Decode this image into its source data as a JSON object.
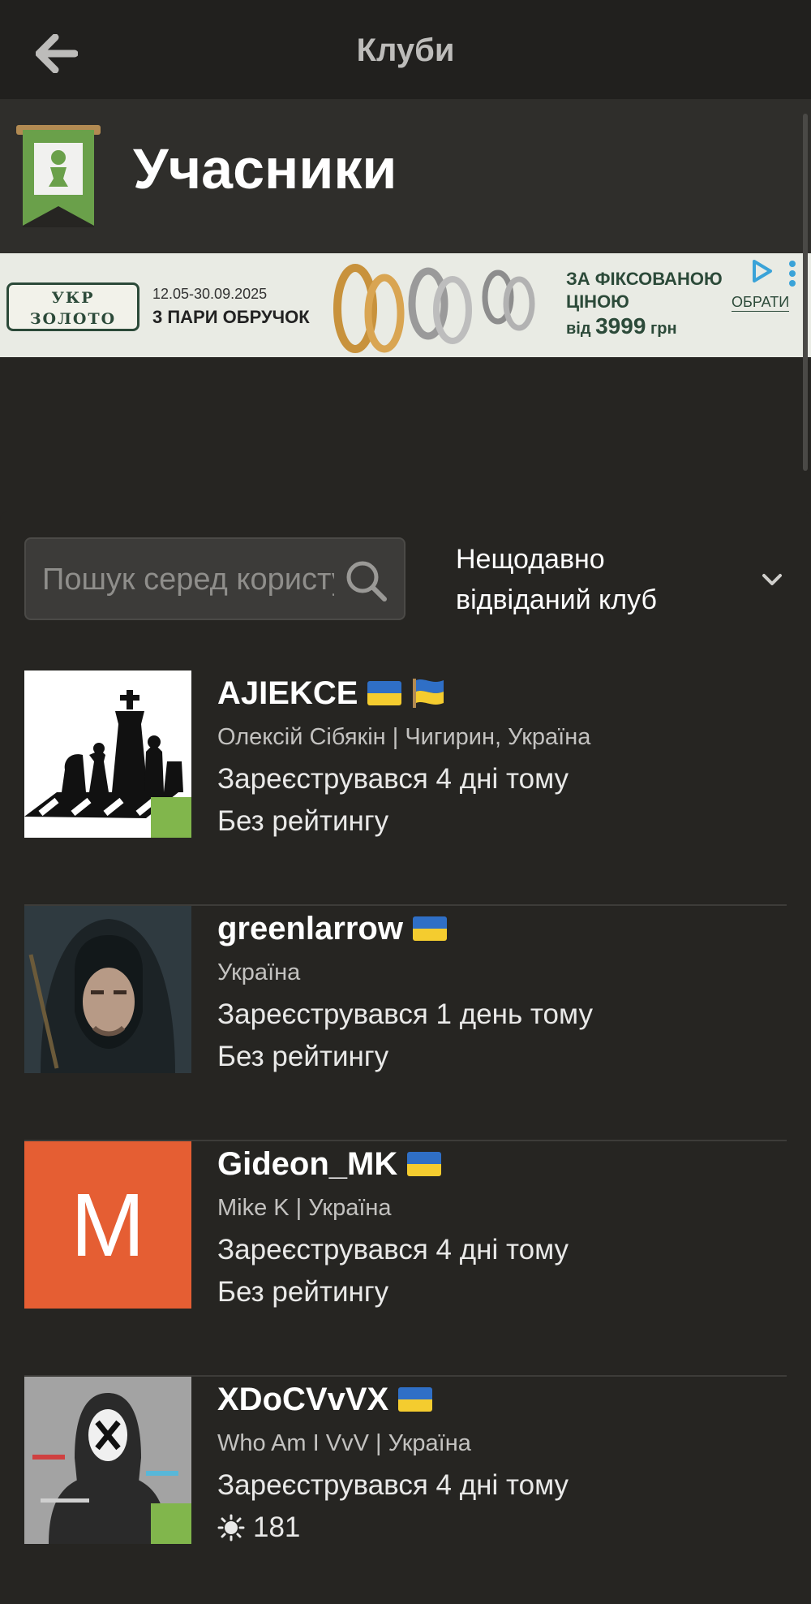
{
  "topbar": {
    "title": "Клуби"
  },
  "header": {
    "title": "Учасники"
  },
  "ad": {
    "brand_line1": "УКР",
    "brand_line2": "ЗОЛОТО",
    "dates": "12.05-30.09.2025",
    "offer": "3 ПАРИ ОБРУЧОК",
    "fixed_line1": "ЗА ФІКСОВАНОЮ",
    "fixed_line2": "ЦІНОЮ",
    "price_prefix": "від",
    "price_value": "3999",
    "price_currency": "грн",
    "cta": "ОБРАТИ"
  },
  "search": {
    "placeholder": "Пошук серед користувачів"
  },
  "filter": {
    "selected": "Нещодавно відвіданий клуб"
  },
  "members": [
    {
      "username": "AJIEKCE",
      "realname": "Олексій Сібякін | Чигирин, Україна",
      "joined": "Зареєструвався 4 дні тому",
      "rating": "Без рейтингу",
      "online": true
    },
    {
      "username": "greenlarrow",
      "realname": "Україна",
      "joined": "Зареєструвався 1 день тому",
      "rating": "Без рейтингу",
      "online": false
    },
    {
      "username": "Gideon_MK",
      "realname": "Mike K | Україна",
      "joined": "Зареєструвався 4 дні тому",
      "rating": "Без рейтингу",
      "online": false,
      "avatar_letter": "M"
    },
    {
      "username": "XDoCVvVX",
      "realname": "Who Am I VvV | Україна",
      "joined": "Зареєструвався 4 дні тому",
      "rating": "181",
      "online": true
    }
  ],
  "colors": {
    "background": "#262522",
    "topbar": "#21201e",
    "header": "#2f2e2b",
    "online": "#81b64c",
    "avatar_orange": "#e55e33"
  }
}
